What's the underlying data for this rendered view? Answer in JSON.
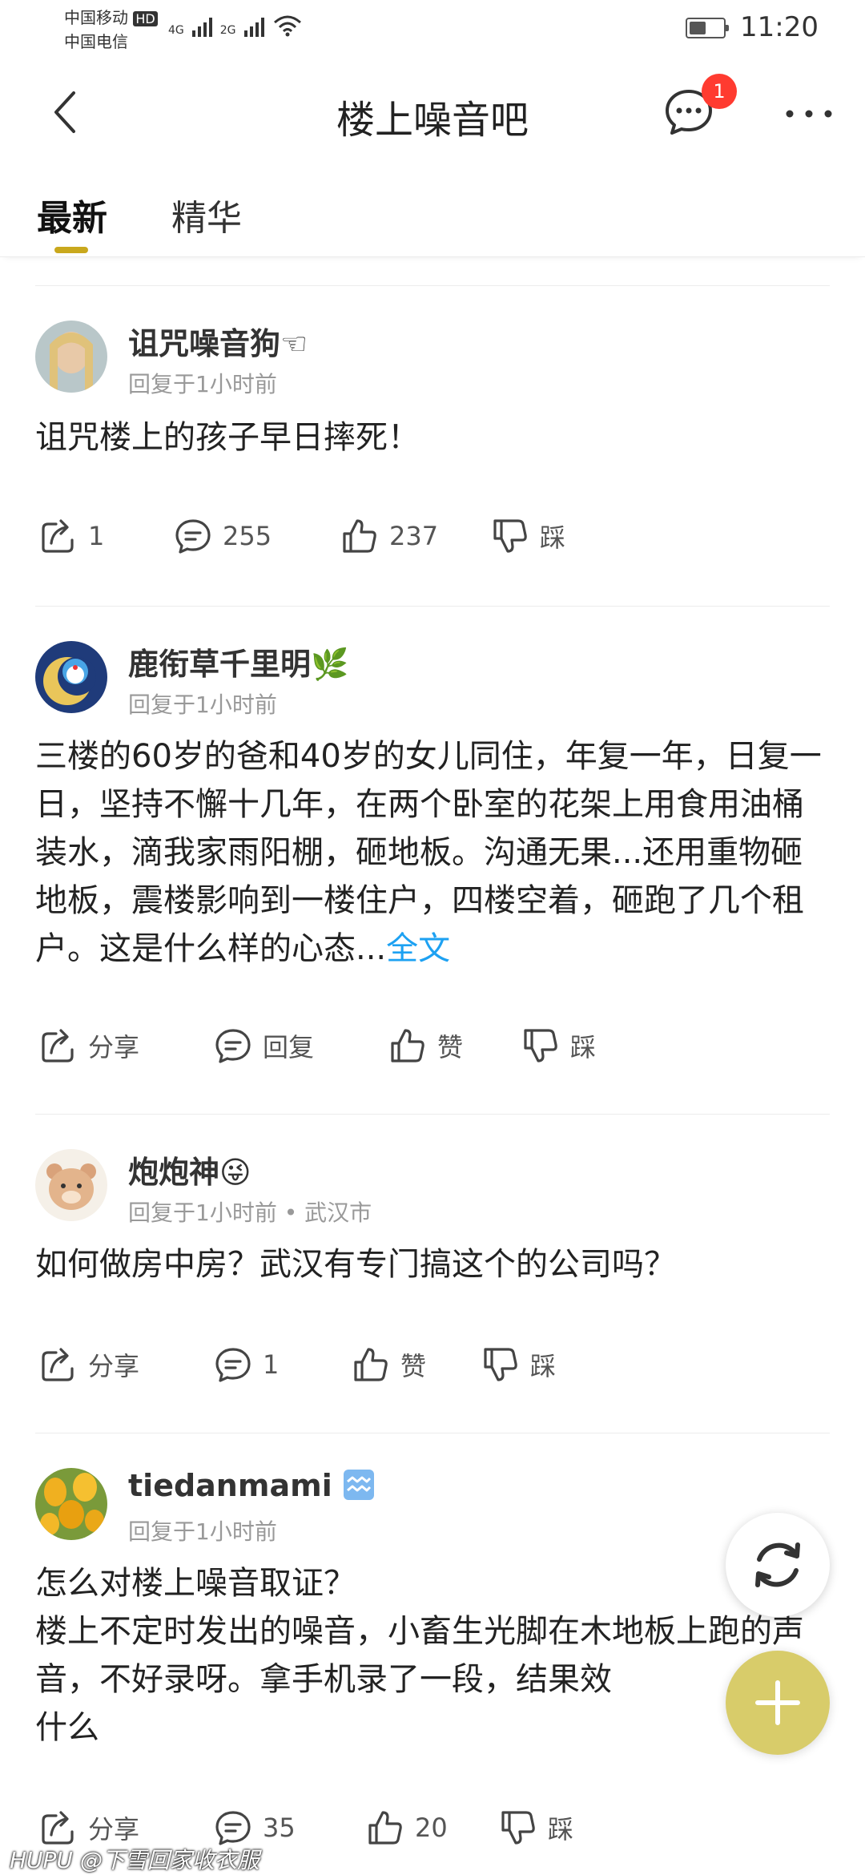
{
  "status": {
    "carrier1": "中国移动",
    "carrier1_badge": "HD",
    "carrier2": "中国电信",
    "net1": "4G",
    "net2": "2G",
    "battery_level": 0.5,
    "time": "11:20"
  },
  "header": {
    "title": "楼上噪音吧",
    "message_badge": "1"
  },
  "tabs": [
    {
      "label": "最新",
      "active": true
    },
    {
      "label": "精华",
      "active": false
    }
  ],
  "posts": [
    {
      "user": "诅咒噪音狗☜",
      "meta": "回复于1小时前",
      "content": "诅咒楼上的孩子早日摔死！",
      "actions": {
        "share": "1",
        "reply": "255",
        "like": "237",
        "dislike": "踩"
      }
    },
    {
      "user": "鹿衔草千里明🌿",
      "meta": "回复于1小时前",
      "content": "三楼的60岁的爸和40岁的女儿同住，年复一年，日复一日，坚持不懈十几年，在两个卧室的花架上用食用油桶装水，滴我家雨阳棚，砸地板。沟通无果...还用重物砸地板，震楼影响到一楼住户，四楼空着，砸跑了几个租户。这是什么样的心态...",
      "more": "全文",
      "actions": {
        "share": "分享",
        "reply": "回复",
        "like": "赞",
        "dislike": "踩"
      }
    },
    {
      "user": "炮炮神😜",
      "meta": "回复于1小时前 • 武汉市",
      "content": "如何做房中房？武汉有专门搞这个的公司吗？",
      "actions": {
        "share": "分享",
        "reply": "1",
        "like": "赞",
        "dislike": "踩"
      }
    },
    {
      "user": "tiedanmami",
      "meta": "回复于1小时前",
      "content": "怎么对楼上噪音取证？\n楼上不定时发出的噪音，小畜生光脚在木地板上跑的声音，不好录呀。拿手机录了一段，结果效\n什么",
      "actions": {
        "share": "分享",
        "reply": "35",
        "like": "20",
        "dislike": "踩"
      }
    }
  ],
  "watermark": "HUPU @下雪回家收衣服"
}
